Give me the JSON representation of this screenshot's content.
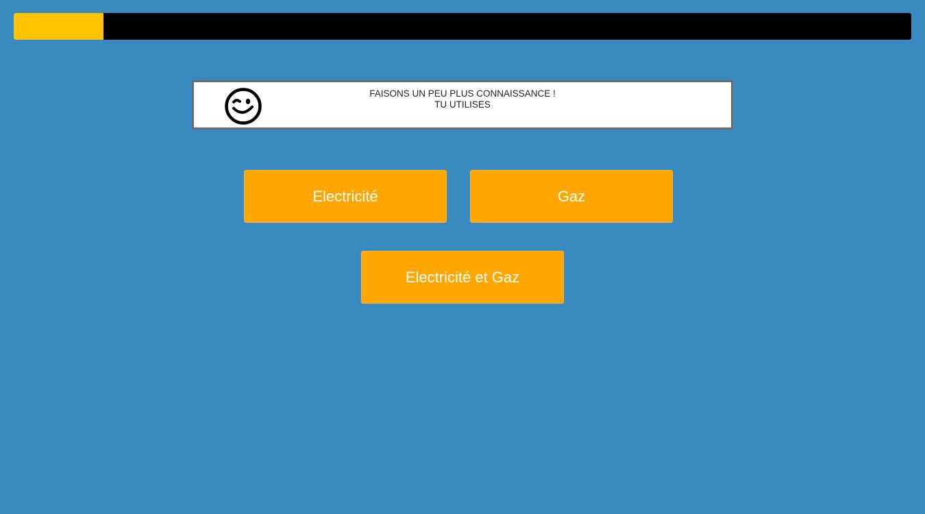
{
  "progress": {
    "fraction": 0.1,
    "fill_color": "#ffc300",
    "track_color": "#000000"
  },
  "message": {
    "icon": "winking-smiley-icon",
    "line1": "FAISONS UN PEU PLUS CONNAISSANCE !",
    "line2": "TU UTILISES"
  },
  "choices": {
    "electricite": "Electricité",
    "gaz": "Gaz",
    "electricite_et_gaz": "Electricité et Gaz"
  },
  "colors": {
    "background": "#3a8ac2",
    "button": "#ffa600",
    "button_text": "#ffffff"
  }
}
